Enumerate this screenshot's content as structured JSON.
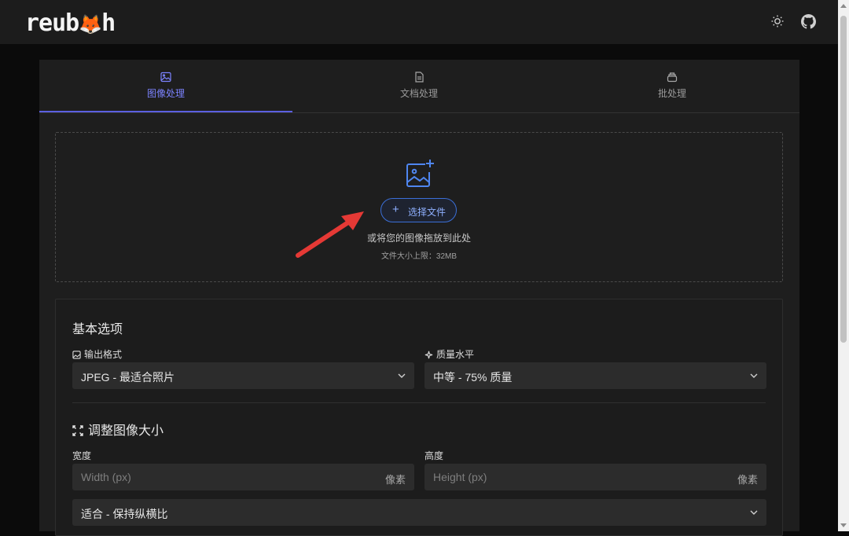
{
  "header": {
    "logo_left": "reub",
    "logo_fox": "🦊",
    "logo_right": "h",
    "theme_icon": "sun-icon",
    "github_icon": "github-icon"
  },
  "tabs": [
    {
      "label": "图像处理",
      "icon": "image-icon",
      "active": true
    },
    {
      "label": "文档处理",
      "icon": "document-icon",
      "active": false
    },
    {
      "label": "批处理",
      "icon": "stack-icon",
      "active": false
    }
  ],
  "upload": {
    "button_label": "选择文件",
    "hint": "或将您的图像拖放到此处",
    "size_limit": "文件大小上限：32MB"
  },
  "basic_options": {
    "title": "基本选项",
    "format_label": "输出格式",
    "format_value": "JPEG - 最适合照片",
    "quality_label": "质量水平",
    "quality_value": "中等 - 75% 质量"
  },
  "resize": {
    "title": "调整图像大小",
    "width_label": "宽度",
    "width_placeholder": "Width (px)",
    "width_suffix": "像素",
    "height_label": "高度",
    "height_placeholder": "Height (px)",
    "height_suffix": "像素",
    "fit_value": "适合 - 保持纵横比"
  },
  "colors": {
    "accent": "#5b5fe0",
    "upload_blue": "#3b6fd8",
    "arrow_red": "#e53935"
  }
}
